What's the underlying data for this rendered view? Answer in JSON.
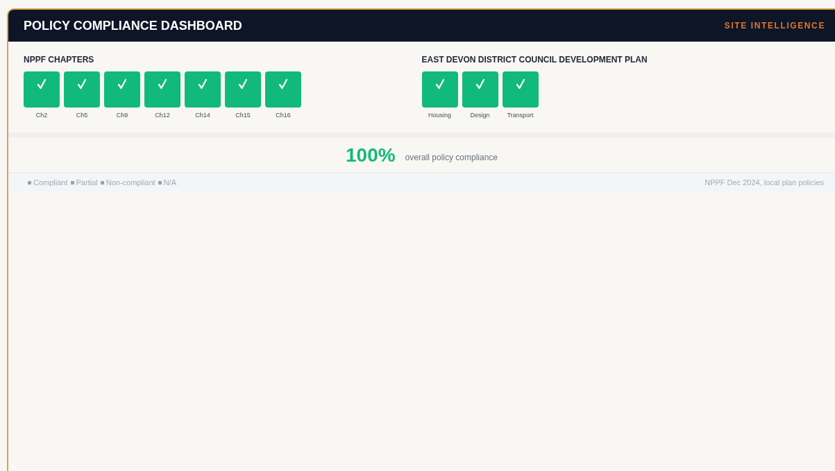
{
  "header": {
    "title": "POLICY COMPLIANCE DASHBOARD",
    "brand": "SITE INTELLIGENCE"
  },
  "groups": [
    {
      "title": "NPPF CHAPTERS",
      "items": [
        {
          "label": "Ch2",
          "kind": "compliant"
        },
        {
          "label": "Ch5",
          "kind": "compliant"
        },
        {
          "label": "Ch9",
          "kind": "compliant"
        },
        {
          "label": "Ch12",
          "kind": "compliant"
        },
        {
          "label": "Ch14",
          "kind": "compliant"
        },
        {
          "label": "Ch15",
          "kind": "compliant"
        },
        {
          "label": "Ch16",
          "kind": "compliant"
        }
      ]
    },
    {
      "title": "EAST DEVON DISTRICT COUNCIL DEVELOPMENT PLAN",
      "items": [
        {
          "label": "Housing",
          "kind": "compliant"
        },
        {
          "label": "Design",
          "kind": "compliant"
        },
        {
          "label": "Transport",
          "kind": "compliant"
        }
      ]
    }
  ],
  "summary": {
    "value": "100%",
    "label": "overall policy compliance"
  },
  "footer": {
    "legend": [
      "Compliant",
      "Partial",
      "Non-compliant",
      "N/A"
    ],
    "source": "NPPF Dec 2024, local plan policies"
  }
}
